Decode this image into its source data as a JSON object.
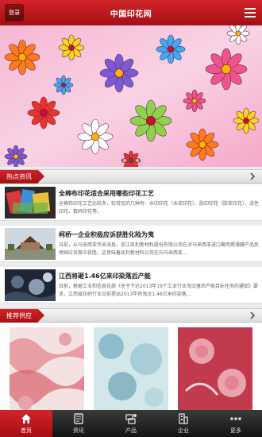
{
  "header": {
    "login_label": "登录",
    "title": "中国印花网",
    "menu_icon": "menu-icon"
  },
  "banner": {
    "slide_count": 3,
    "active_slide": 1
  },
  "hot_news": {
    "section_title": "热点资讯",
    "items": [
      {
        "title": "全棉布印花适合采用哪些印花工艺",
        "desc": "全棉布印花工艺比较多，较常见的几种有：水印印花（水浆印花）、胶印印花（胶浆印花）、活性印花、数码印花等。"
      },
      {
        "title": "柯桥一企业积极应诉获胜化险为夷",
        "desc": "日前，从马来西亚传来消息，浙江凯利新材料股份有限公司在对马来西亚进口聚丙烯薄膜产品反倾销应诉案中获胜。这意味着凯利新材料公司在向马来西亚..."
      },
      {
        "title": "江西将砸1.46亿来印染落后产能",
        "desc": "日前，根据工业和信息化部《关于下达2013年19个工业行业淘汰落后产能目标任务的通知》要求，江西省纺织行业日前提出2013年将淘汰1.46亿米印染落..."
      }
    ]
  },
  "supply": {
    "section_title": "推荐供应"
  },
  "bottom_nav": {
    "items": [
      {
        "label": "首页",
        "icon": "home-icon",
        "active": true
      },
      {
        "label": "资讯",
        "icon": "news-icon",
        "active": false
      },
      {
        "label": "产品",
        "icon": "product-icon",
        "active": false
      },
      {
        "label": "企业",
        "icon": "company-icon",
        "active": false
      },
      {
        "label": "更多",
        "icon": "more-icon",
        "active": false
      }
    ]
  },
  "colors": {
    "brand_red": "#c0181e",
    "nav_dark": "#222222"
  }
}
